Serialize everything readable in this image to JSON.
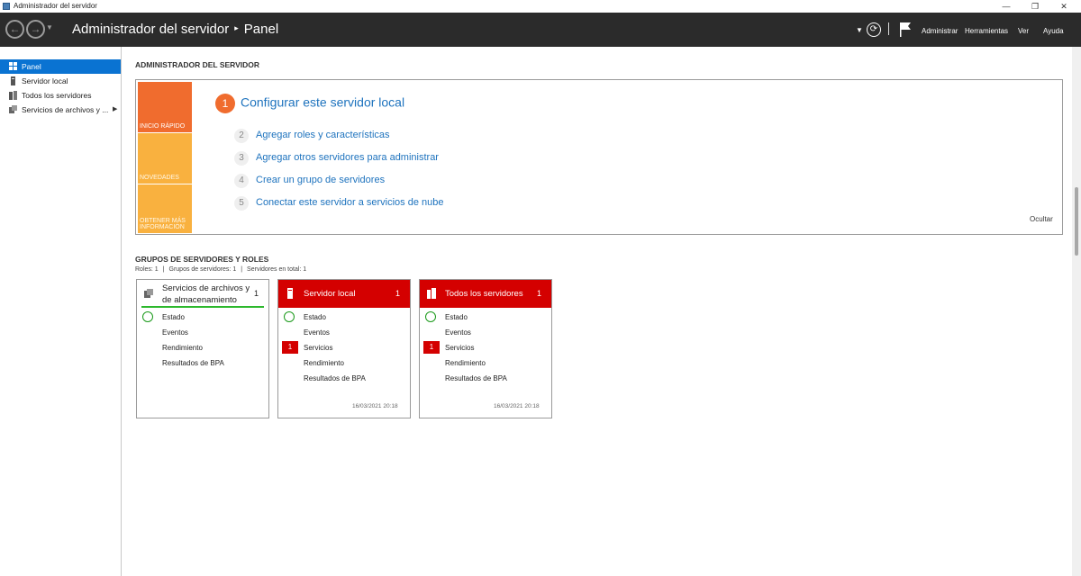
{
  "window": {
    "title": "Administrador del servidor",
    "controls": {
      "minimize": "—",
      "maximize": "❐",
      "close": "✕"
    }
  },
  "header": {
    "breadcrumb_root": "Administrador del servidor",
    "breadcrumb_sep": "▸",
    "breadcrumb_page": "Panel",
    "menu": [
      "Administrar",
      "Herramientas",
      "Ver",
      "Ayuda"
    ]
  },
  "sidebar": {
    "items": [
      {
        "label": "Panel",
        "icon": "dashboard-icon",
        "active": true
      },
      {
        "label": "Servidor local",
        "icon": "server-icon",
        "active": false
      },
      {
        "label": "Todos los servidores",
        "icon": "servers-icon",
        "active": false
      },
      {
        "label": "Servicios de archivos y ...",
        "icon": "file-services-icon",
        "active": false,
        "has_arrow": true
      }
    ]
  },
  "main": {
    "section_title": "ADMINISTRADOR DEL SERVIDOR",
    "welcome": {
      "tiles": [
        "INICIO RÁPIDO",
        "NOVEDADES",
        "OBTENER MÁS INFORMACIÓN"
      ],
      "primary_step": {
        "num": "1",
        "label": "Configurar este servidor local"
      },
      "steps": [
        {
          "num": "2",
          "label": "Agregar roles y características"
        },
        {
          "num": "3",
          "label": "Agregar otros servidores para administrar"
        },
        {
          "num": "4",
          "label": "Crear un grupo de servidores"
        },
        {
          "num": "5",
          "label": "Conectar este servidor a servicios de nube"
        }
      ],
      "hide_label": "Ocultar"
    },
    "groups": {
      "title": "GRUPOS DE SERVIDORES Y ROLES",
      "summary": [
        "Roles: 1",
        "Grupos de servidores: 1",
        "Servidores en total: 1"
      ],
      "cards": [
        {
          "title": "Servicios de archivos y de almacenamiento",
          "count": "1",
          "rows": [
            "Estado",
            "Eventos",
            "Rendimiento",
            "Resultados de BPA"
          ],
          "timestamp": ""
        },
        {
          "title": "Servidor local",
          "count": "1",
          "rows": [
            "Estado",
            "Eventos",
            "Servicios",
            "Rendimiento",
            "Resultados de BPA"
          ],
          "services_badge": "1",
          "timestamp": "16/03/2021 20:18"
        },
        {
          "title": "Todos los servidores",
          "count": "1",
          "rows": [
            "Estado",
            "Eventos",
            "Servicios",
            "Rendimiento",
            "Resultados de BPA"
          ],
          "services_badge": "1",
          "timestamp": "16/03/2021 20:18"
        }
      ]
    }
  },
  "colors": {
    "header_bg": "#2b2b2b",
    "sidebar_active": "#0a73d2",
    "quick_start_tile": "#f06c2e",
    "info_tiles": "#f9b13f",
    "link": "#1e73be",
    "alert_red": "#d40000",
    "ok_green": "#1b9a1b"
  }
}
